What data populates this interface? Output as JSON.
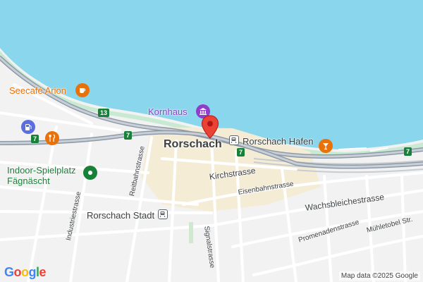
{
  "map": {
    "city_label": "Rorschach",
    "attribution": "Map data ©2025 Google",
    "logo_letters": [
      "G",
      "o",
      "o",
      "g",
      "l",
      "e"
    ],
    "logo_colors": [
      "#4285F4",
      "#EA4335",
      "#FBBC05",
      "#4285F4",
      "#34A853",
      "#EA4335"
    ],
    "colors": {
      "water": "#8ad6ec",
      "land": "#f2f2f2",
      "road": "#ffffff",
      "highway": "#8e9aa8",
      "urban": "#f5ecd6",
      "marker": "#ea4335",
      "poi_orange": "#e8710a",
      "poi_green": "#188038",
      "poi_purple": "#8e3ec9"
    }
  },
  "streets": [
    "Kirchstrasse",
    "Eisenbahnstrasse",
    "Wachsbleichestrasse",
    "Promenadenstrasse",
    "Mühletobel Str.",
    "Reitbahnstrasse",
    "Industriestrasse",
    "Signalstrasse"
  ],
  "road_shields": [
    "13",
    "7",
    "7",
    "7",
    "7"
  ],
  "pois": {
    "seecafe": {
      "label": "Seecafé Arion",
      "icon": "coffee-cup-icon"
    },
    "kornhaus": {
      "label": "Kornhaus",
      "icon": "museum-icon"
    },
    "restaurant": {
      "icon": "fork-knife-icon"
    },
    "fuel": {
      "icon": "gas-station-icon"
    },
    "spielplatz": {
      "label_line1": "Indoor-Spielplatz",
      "label_line2": "Fägnäscht",
      "icon": "park-icon"
    },
    "bar": {
      "icon": "cocktail-icon"
    }
  },
  "transit": {
    "hafen": {
      "label": "Rorschach Hafen",
      "icon": "train-station-icon"
    },
    "stadt": {
      "label": "Rorschach Stadt",
      "icon": "train-station-icon"
    }
  },
  "marker": {
    "icon": "map-pin-icon"
  }
}
